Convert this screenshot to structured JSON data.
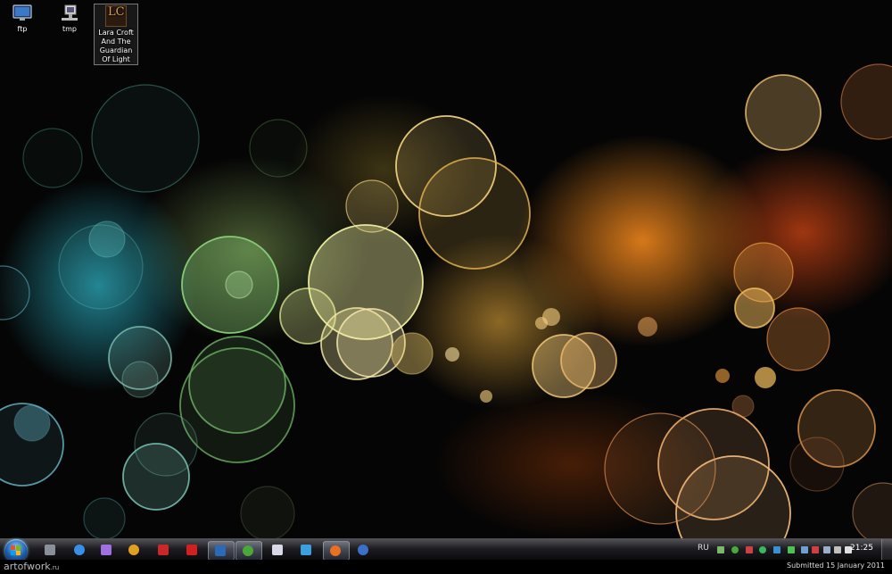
{
  "desktop": {
    "icons": [
      {
        "label": "ftp",
        "icon": "monitor-icon"
      },
      {
        "label": "tmp",
        "icon": "network-computer-icon"
      },
      {
        "label": "Lara Croft And The Guardian Of Light",
        "icon": "game-shortcut-icon",
        "logo_text": "LC"
      }
    ]
  },
  "taskbar": {
    "start_button": "windows-start-orb",
    "pinned": [
      {
        "name": "file-manager",
        "color": "#8a8f9a"
      },
      {
        "name": "internet-explorer",
        "color": "#3a8ee8"
      },
      {
        "name": "media-player",
        "color": "#a070e0"
      },
      {
        "name": "chrome-like-browser",
        "color": "#e0a020"
      },
      {
        "name": "filezilla",
        "color": "#c8282a"
      },
      {
        "name": "red-app",
        "color": "#d02020"
      },
      {
        "name": "photoshop",
        "color": "#2a6ab8",
        "active": true
      },
      {
        "name": "utorrent",
        "color": "#4aa83a",
        "active": true
      },
      {
        "name": "messenger",
        "color": "#d8d8e8"
      },
      {
        "name": "skype-like",
        "color": "#3aa0e0"
      },
      {
        "name": "firefox",
        "color": "#e87020",
        "active": true
      },
      {
        "name": "thunderbird",
        "color": "#3a70c8"
      }
    ],
    "language": "RU",
    "tray_icons": [
      {
        "name": "network-icon",
        "color": "#7ab86a"
      },
      {
        "name": "utorrent-tray-icon",
        "color": "#4aa83a"
      },
      {
        "name": "security-tray-icon",
        "color": "#d04040"
      },
      {
        "name": "app-tray-icon",
        "color": "#3ab860"
      },
      {
        "name": "download-tray-icon",
        "color": "#3a90d0"
      },
      {
        "name": "green-tray-icon",
        "color": "#50c050"
      },
      {
        "name": "vpn-tray-icon",
        "color": "#70a0d0"
      },
      {
        "name": "flag-tray-icon",
        "color": "#d04040"
      },
      {
        "name": "monitor-tray-icon",
        "color": "#9ab0c8"
      },
      {
        "name": "usb-tray-icon",
        "color": "#c0c0c0"
      },
      {
        "name": "volume-tray-icon",
        "color": "#e0e0e0"
      }
    ],
    "clock": "21:25"
  },
  "footer": {
    "watermark": "artofwork",
    "watermark_suffix": ".ru",
    "submitted": "Submitted 15 January 2011"
  }
}
